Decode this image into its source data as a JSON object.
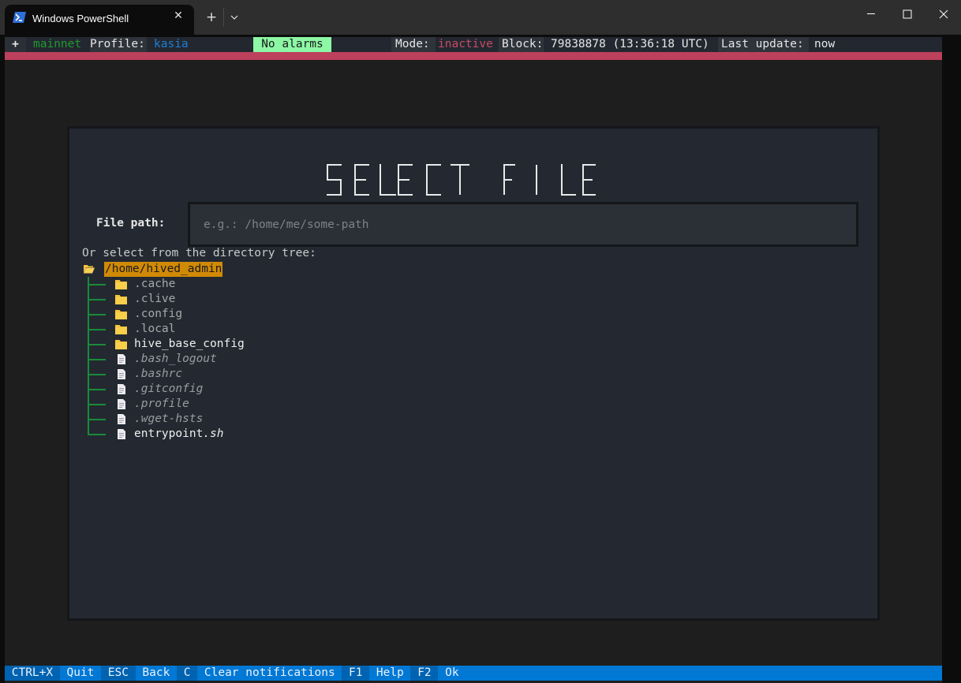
{
  "window": {
    "tab_title": "Windows PowerShell",
    "tab_icon": "powershell-icon",
    "close_tab_symbol": "✕",
    "new_tab_symbol": "+",
    "controls": [
      "minimize-icon",
      "maximize-icon",
      "close-icon"
    ]
  },
  "statusbar": {
    "plus": "+",
    "network": "mainnet",
    "profile_label": "Profile:",
    "profile_value": "kasia",
    "alarms": "No alarms",
    "mode_label": "Mode:",
    "mode_value": "inactive",
    "block_label": "Block:",
    "block_value": "79838878 (13:36:18 UTC)",
    "update_label": "Last update:",
    "update_value": "now"
  },
  "colors": {
    "accent_red": "#bd405c",
    "alarm_ok": "#8cf7a4",
    "network": "#1f9a2d",
    "profile": "#1b7fd6",
    "mode_inactive": "#c84a64",
    "root_highlight": "#d18a06",
    "footer": "#0078d4",
    "tree_lines": "#1b8a3a"
  },
  "dialog": {
    "title": "SELECT FILE",
    "file_path_label": "File path:",
    "file_path_value": "",
    "file_path_placeholder": "e.g.: /home/me/some-path",
    "tree_hint": "Or select from the directory tree:",
    "tree": {
      "root": "/home/hived_admin",
      "items": [
        {
          "name": ".cache",
          "type": "folder",
          "hidden": true
        },
        {
          "name": ".clive",
          "type": "folder",
          "hidden": true
        },
        {
          "name": ".config",
          "type": "folder",
          "hidden": true
        },
        {
          "name": ".local",
          "type": "folder",
          "hidden": true
        },
        {
          "name": "hive_base_config",
          "type": "folder",
          "hidden": false
        },
        {
          "name": ".bash_logout",
          "type": "file",
          "hidden": true
        },
        {
          "name": ".bashrc",
          "type": "file",
          "hidden": true
        },
        {
          "name": ".gitconfig",
          "type": "file",
          "hidden": true
        },
        {
          "name": ".profile",
          "type": "file",
          "hidden": true
        },
        {
          "name": ".wget-hsts",
          "type": "file",
          "hidden": true
        },
        {
          "name": "entrypoint",
          "ext": ".sh",
          "type": "file",
          "hidden": false
        }
      ]
    }
  },
  "footer": {
    "bindings": [
      {
        "key": "CTRL+X",
        "action": "Quit"
      },
      {
        "key": "ESC",
        "action": "Back"
      },
      {
        "key": "C",
        "action": "Clear notifications"
      },
      {
        "key": "F1",
        "action": "Help"
      },
      {
        "key": "F2",
        "action": "Ok"
      }
    ]
  }
}
